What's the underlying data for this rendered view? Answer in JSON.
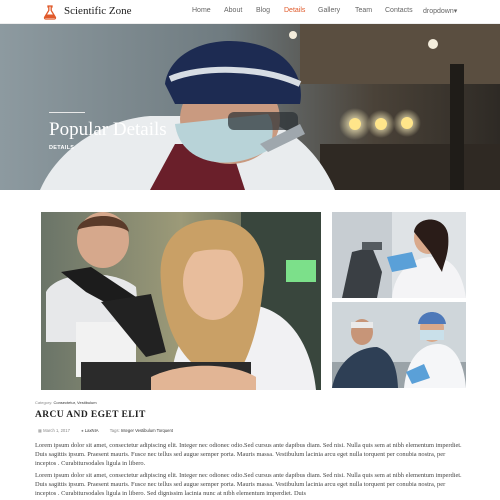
{
  "nav": {
    "brand": "Scientific Zone",
    "items": [
      {
        "label": "Home",
        "active": false
      },
      {
        "label": "About",
        "active": false
      },
      {
        "label": "Blog",
        "active": false
      },
      {
        "label": "Details",
        "active": true
      },
      {
        "label": "Gallery",
        "active": false
      },
      {
        "label": "Team",
        "active": false
      },
      {
        "label": "Contacts",
        "active": false
      },
      {
        "label": "dropdown▾",
        "active": false
      }
    ],
    "accent_color": "#e05a2b",
    "logo_icon": "flask-icon"
  },
  "hero": {
    "title": "Popular Details",
    "subtitle": "DETAILS"
  },
  "post": {
    "category_prefix": "Category:",
    "categories": "Consectetur, Vestibulum",
    "title": "ARCU AND EGET ELIT",
    "date": "March 1, 2017",
    "author": "LaxNIA",
    "tags_prefix": "Tags:",
    "tags": "Integer Vestibulum Torquent",
    "paragraphs": [
      "Lorem ipsum dolor sit amet, consectetur adipiscing elit. Integer nec odionec odio.Sed cursus ante dapibus diam. Sed nisi. Nulla quis sem at nibh elementum imperdiet. Duis sagittis ipsum. Praesent mauris. Fusce nec tellus sed augue semper porta. Mauris massa. Vestibulum lacinia arcu eget nulla torquent per conubia nostra, per inceptos . Curabitursodales ligula in libero.",
      "Lorem ipsum dolor sit amet, consectetur adipiscing elit. Integer nec odionec odio.Sed cursus ante dapibus diam. Sed nisi. Nulla quis sem at nibh elementum imperdiet. Duis sagittis ipsum. Praesent mauris. Fusce nec tellus sed augue semper porta. Mauris massa. Vestibulum lacinia arcu eget nulla torquent per conubia nostra, per inceptos . Curabitursodales ligula in libero. Sed dignissim lacinia nunc at nibh elementum imperdiet. Duis"
    ]
  }
}
